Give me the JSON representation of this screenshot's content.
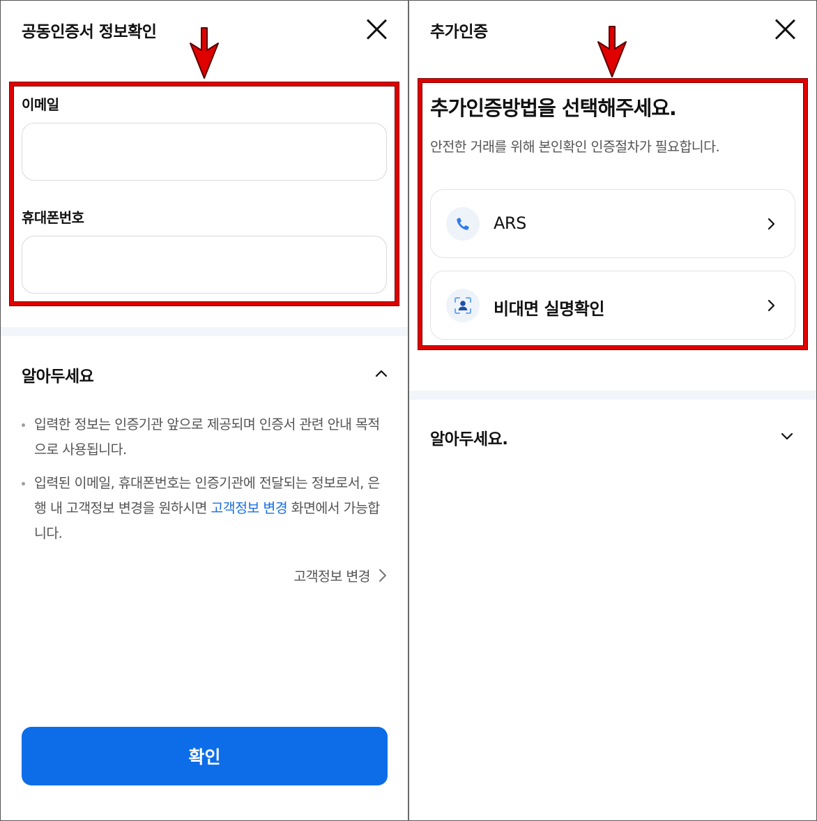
{
  "left_panel": {
    "title": "공동인증서 정보확인",
    "email_label": "이메일",
    "email_value": "",
    "phone_label": "휴대폰번호",
    "phone_value": "",
    "notice_title": "알아두세요",
    "notice_items": [
      "입력한 정보는 인증기관 앞으로 제공되며 인증서 관련 안내 목적으로 사용됩니다.",
      {
        "before": "입력된 이메일, 휴대폰번호는 인증기관에 전달되는 정보로서, 은행 내 고객정보 변경을 원하시면 ",
        "link": "고객정보 변경",
        "after": " 화면에서 가능합니다."
      }
    ],
    "customer_info_link": "고객정보 변경",
    "confirm_button": "확인"
  },
  "right_panel": {
    "title": "추가인증",
    "heading": "추가인증방법을 선택해주세요.",
    "subtext": "안전한 거래를 위해 본인확인 인증절차가 필요합니다.",
    "options": [
      {
        "label": "ARS",
        "icon": "phone-icon"
      },
      {
        "label": "비대면 실명확인",
        "icon": "face-scan-icon"
      }
    ],
    "notice_title": "알아두세요."
  },
  "colors": {
    "highlight_box": "#e00000",
    "primary_button": "#0d6de8",
    "link": "#1a6fe0",
    "section_band": "#f2f5f9"
  }
}
